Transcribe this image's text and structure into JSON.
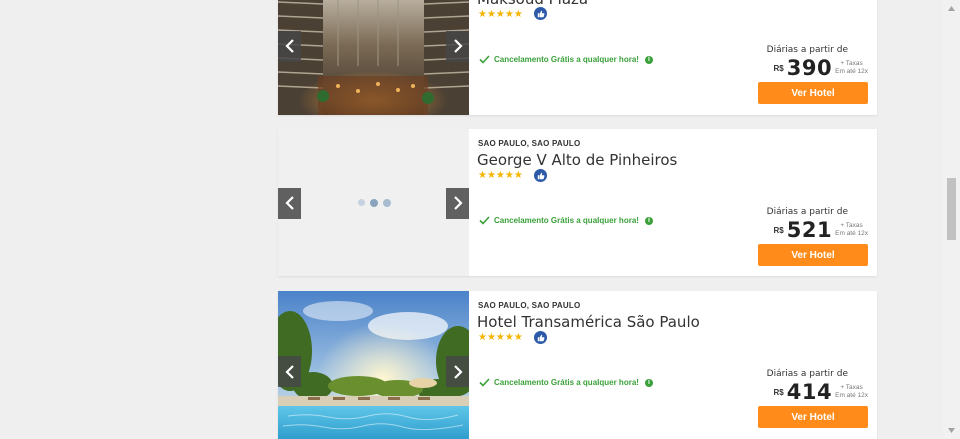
{
  "hotels": [
    {
      "city": "",
      "name": "Maksoud Plaza",
      "stars": "★★★★★",
      "cancel_text": "Cancelamento Grátis a qualquer hora!",
      "price_from": "Diárias a partir de",
      "currency": "R$",
      "amount": "390",
      "taxes_line1": "+ Taxas",
      "taxes_line2": "Em até 12x",
      "button": "Ver Hotel"
    },
    {
      "city": "SAO PAULO, SAO PAULO",
      "name": "George V Alto de Pinheiros",
      "stars": "★★★★★",
      "cancel_text": "Cancelamento Grátis a qualquer hora!",
      "price_from": "Diárias a partir de",
      "currency": "R$",
      "amount": "521",
      "taxes_line1": "+ Taxas",
      "taxes_line2": "Em até 12x",
      "button": "Ver Hotel"
    },
    {
      "city": "SAO PAULO, SAO PAULO",
      "name": "Hotel Transamérica São Paulo",
      "stars": "★★★★★",
      "cancel_text": "Cancelamento Grátis a qualquer hora!",
      "price_from": "Diárias a partir de",
      "currency": "R$",
      "amount": "414",
      "taxes_line1": "+ Taxas",
      "taxes_line2": "Em até 12x",
      "button": "Ver Hotel"
    }
  ],
  "colors": {
    "accent": "#ff8c1a",
    "stars": "#f5b400",
    "cancel": "#3aa13a",
    "thumb_badge": "#2d5aa8"
  },
  "icons": {
    "prev": "chevron-left-icon",
    "next": "chevron-right-icon",
    "check": "check-icon",
    "info": "info-icon",
    "thumbs": "thumbs-up-icon"
  }
}
